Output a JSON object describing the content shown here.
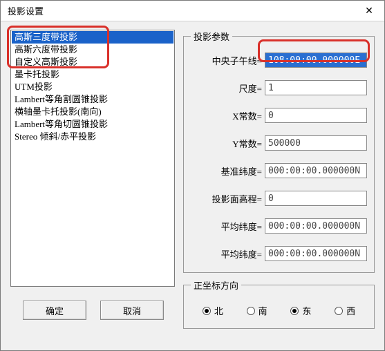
{
  "window": {
    "title": "投影设置",
    "close_glyph": "✕"
  },
  "listbox": {
    "items": [
      "高斯三度带投影",
      "高斯六度带投影",
      "自定义高斯投影",
      "墨卡托投影",
      "UTM投影",
      "Lambert等角割圆锥投影",
      "横轴墨卡托投影(南向)",
      "Lambert等角切圆锥投影",
      "Stereo 倾斜/赤平投影"
    ],
    "selected_index": 0
  },
  "buttons": {
    "ok": "确定",
    "cancel": "取消"
  },
  "params": {
    "legend": "投影参数",
    "rows": [
      {
        "label": "中央子午线=",
        "value": "108:00:00.000000E",
        "selected": true
      },
      {
        "label": "尺度=",
        "value": "1",
        "selected": false
      },
      {
        "label": "X常数=",
        "value": "0",
        "selected": false
      },
      {
        "label": "Y常数=",
        "value": "500000",
        "selected": false
      },
      {
        "label": "基准纬度=",
        "value": "000:00:00.000000N",
        "selected": false
      },
      {
        "label": "投影面高程=",
        "value": "0",
        "selected": false
      },
      {
        "label": "平均纬度=",
        "value": "000:00:00.000000N",
        "selected": false
      },
      {
        "label": "平均纬度=",
        "value": "000:00:00.000000N",
        "selected": false
      }
    ]
  },
  "direction": {
    "legend": "正坐标方向",
    "options": [
      "北",
      "南",
      "东",
      "西"
    ],
    "checked": [
      true,
      false,
      true,
      false
    ]
  }
}
